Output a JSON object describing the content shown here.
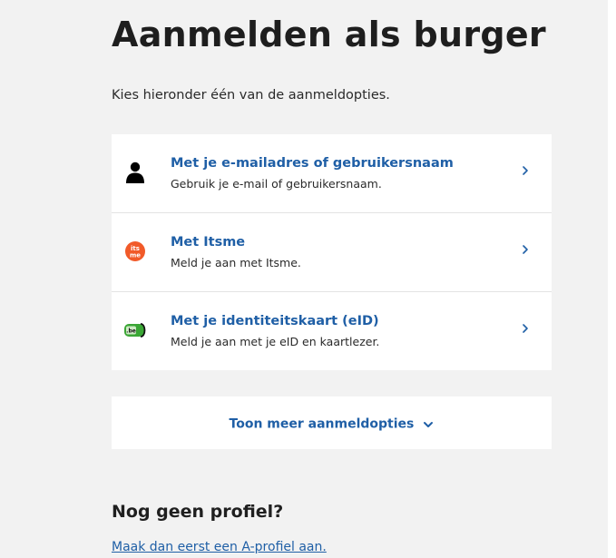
{
  "page": {
    "title": "Aanmelden als burger",
    "intro": "Kies hieronder één van de aanmeldopties."
  },
  "options": [
    {
      "title": "Met je e-mailadres of gebruikersnaam",
      "description": "Gebruik je e-mail of gebruikersnaam.",
      "icon": "user-icon"
    },
    {
      "title": "Met Itsme",
      "description": "Meld je aan met Itsme.",
      "icon": "itsme-logo-icon",
      "icon_text": "its me"
    },
    {
      "title": "Met je identiteitskaart (eID)",
      "description": "Meld je aan met je eID en kaartlezer.",
      "icon": "eid-card-icon",
      "icon_text": ".be"
    }
  ],
  "more": {
    "label": "Toon meer aanmeldopties",
    "icon": "chevron-down-icon"
  },
  "signup": {
    "heading": "Nog geen profiel?",
    "link": "Maak dan eerst een A-profiel aan."
  },
  "colors": {
    "link_blue": "#1f5fa6",
    "background_gray": "#f2f2f2",
    "itsme_orange": "#f15a29",
    "eid_green": "#3aa635"
  }
}
